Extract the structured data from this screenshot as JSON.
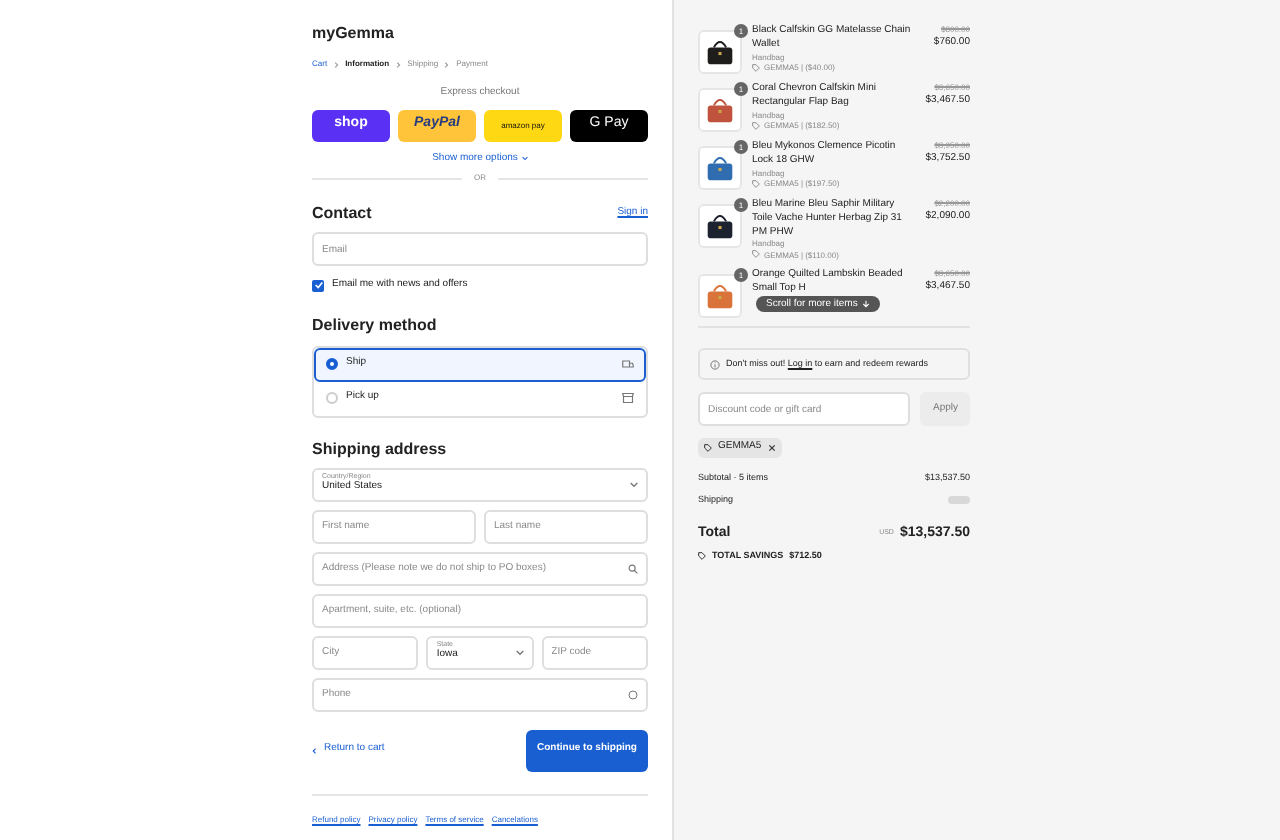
{
  "store": {
    "name": "myGemma"
  },
  "breadcrumb": [
    {
      "label": "Cart",
      "selected": false
    },
    {
      "label": "Information",
      "selected": true
    },
    {
      "label": "Shipping",
      "selected": false
    },
    {
      "label": "Payment",
      "selected": false
    }
  ],
  "express": {
    "title": "Express checkout",
    "buttons": [
      {
        "kind": "shop",
        "label": "shop"
      },
      {
        "kind": "paypal",
        "label": "PayPal"
      },
      {
        "kind": "amazon",
        "label": "amazon pay"
      },
      {
        "kind": "gpay",
        "label": "G Pay"
      }
    ],
    "more": "Show more options",
    "or": "OR"
  },
  "contact": {
    "title": "Contact",
    "sign_in": "Sign in",
    "email_placeholder": "Email",
    "news": {
      "label": "Email me with news and offers",
      "checked": true
    }
  },
  "delivery": {
    "title": "Delivery method",
    "options": [
      {
        "label": "Ship",
        "selected": true,
        "kind": "truck"
      },
      {
        "label": "Pick up",
        "selected": false,
        "kind": "store"
      }
    ]
  },
  "shipping": {
    "title": "Shipping address",
    "country_label": "Country/Region",
    "country": "United States",
    "first_name_placeholder": "First name",
    "last_name_placeholder": "Last name",
    "address_placeholder": "Address (Please note we do not ship to PO boxes)",
    "apartment_placeholder": "Apartment, suite, etc. (optional)",
    "city_placeholder": "City",
    "state_label": "State",
    "state": "Iowa",
    "zip_placeholder": "ZIP code",
    "phone_placeholder": "Phone"
  },
  "actions": {
    "back": "Return to cart",
    "continue": "Continue to shipping"
  },
  "footer_links": [
    "Refund policy",
    "Privacy policy",
    "Terms of service",
    "Cancelations"
  ],
  "items": [
    {
      "qty": "1",
      "name": "Black Calfskin GG Matelasse Chain Wallet",
      "category": "Handbag",
      "discount": "GEMMA5 | ($40.00)",
      "was": "$800.00",
      "price": "$760.00"
    },
    {
      "qty": "1",
      "name": "Coral Chevron Calfskin Mini Rectangular Flap Bag",
      "category": "Handbag",
      "discount": "GEMMA5 | ($182.50)",
      "was": "$3,650.00",
      "price": "$3,467.50"
    },
    {
      "qty": "1",
      "name": "Bleu Mykonos Clemence Picotin Lock 18 GHW",
      "category": "Handbag",
      "discount": "GEMMA5 | ($197.50)",
      "was": "$3,950.00",
      "price": "$3,752.50"
    },
    {
      "qty": "1",
      "name": "Bleu Marine Bleu Saphir Military Toile Vache Hunter Herbag Zip 31 PM PHW",
      "category": "Handbag",
      "discount": "GEMMA5 | ($110.00)",
      "was": "$2,200.00",
      "price": "$2,090.00"
    },
    {
      "qty": "1",
      "name": "Orange Quilted Lambskin Beaded Small Top H",
      "was": "$3,650.00",
      "price": "$3,467.50"
    }
  ],
  "scroll_hint": "Scroll for more items",
  "rewards": {
    "before": "Don't miss out!",
    "link": "Log in",
    "after": "to earn and redeem rewards"
  },
  "discount": {
    "placeholder": "Discount code or gift card",
    "apply": "Apply",
    "code": "GEMMA5"
  },
  "summary": {
    "subtotal_label": "Subtotal · 5 items",
    "subtotal": "$13,537.50",
    "shipping_label": "Shipping",
    "total_label": "Total",
    "currency": "USD",
    "total": "$13,537.50",
    "savings_label": "TOTAL SAVINGS",
    "savings": "$712.50"
  }
}
